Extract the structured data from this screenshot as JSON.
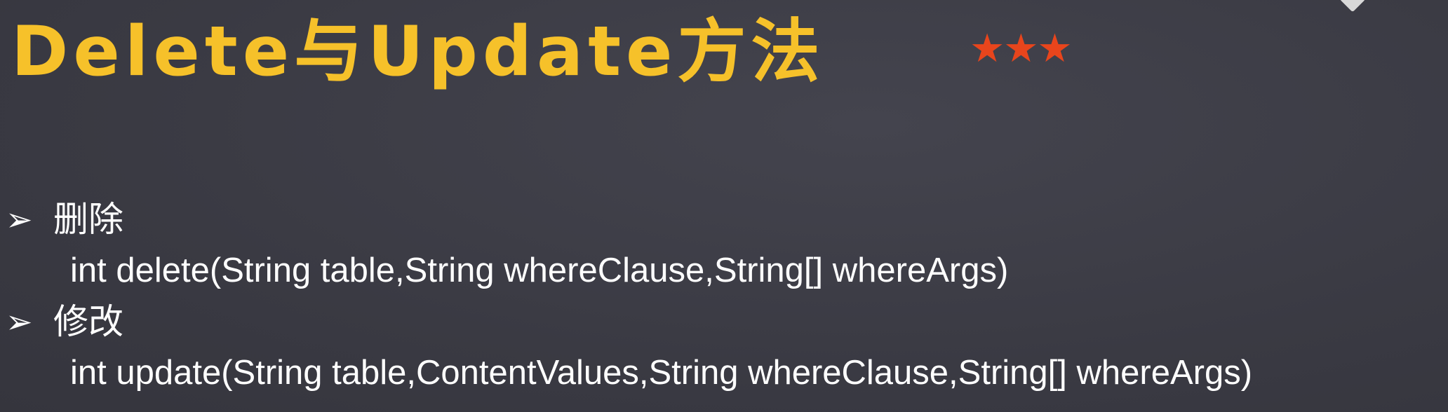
{
  "slide": {
    "title": "Delete与Update方法",
    "stars": "★★★",
    "items": [
      {
        "arrow": "➢",
        "label": "删除",
        "code": "int delete(String table,String whereClause,String[] whereArgs)"
      },
      {
        "arrow": "➢",
        "label": "修改",
        "code": "int update(String table,ContentValues,String whereClause,String[] whereArgs)"
      }
    ]
  },
  "colors": {
    "background": "#3d3d46",
    "title": "#f6c12a",
    "stars": "#e8451c",
    "text": "#ffffff"
  }
}
